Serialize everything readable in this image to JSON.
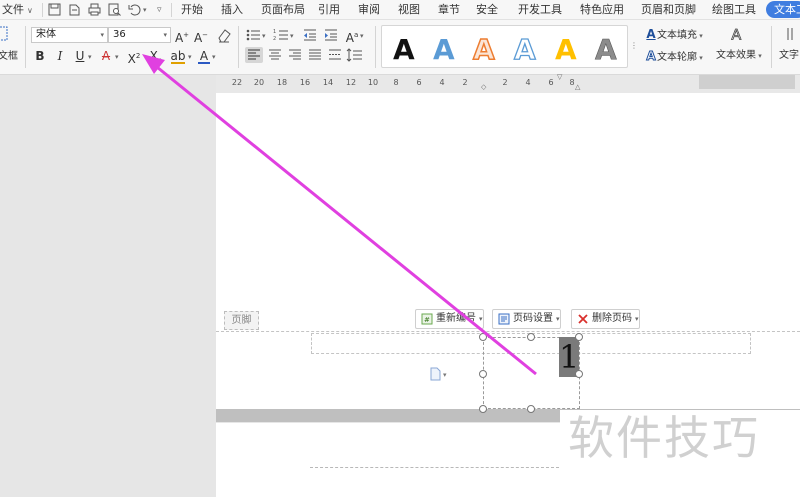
{
  "menubar": {
    "file_label": "文件",
    "tabs": [
      "开始",
      "插入",
      "页面布局",
      "引用",
      "审阅",
      "视图",
      "章节",
      "安全",
      "开发工具",
      "特色应用",
      "页眉和页脚",
      "绘图工具"
    ],
    "active_tab": "文本工",
    "active_color": "#3f7de0"
  },
  "ribbon": {
    "font_name": "宋体",
    "font_size": "36",
    "left_cut_label": "文框",
    "text_fill_label": "文本填充",
    "text_outline_label": "文本轮廓",
    "text_effect_label": "文本效果",
    "text_right_cut": "文字",
    "wordart_letter": "A"
  },
  "ruler": {
    "ticks": [
      "22",
      "20",
      "18",
      "16",
      "14",
      "12",
      "10",
      "8",
      "6",
      "4",
      "2",
      "",
      "2",
      "4",
      "6",
      "8"
    ]
  },
  "footer": {
    "label": "页脚",
    "renumber_label": "重新编号",
    "page_setup_label": "页码设置",
    "delete_page_number_label": "删除页码",
    "page_number": "1"
  },
  "watermark": {
    "text": "软件技巧"
  },
  "annotation": {
    "arrow_color": "#e040e0"
  }
}
